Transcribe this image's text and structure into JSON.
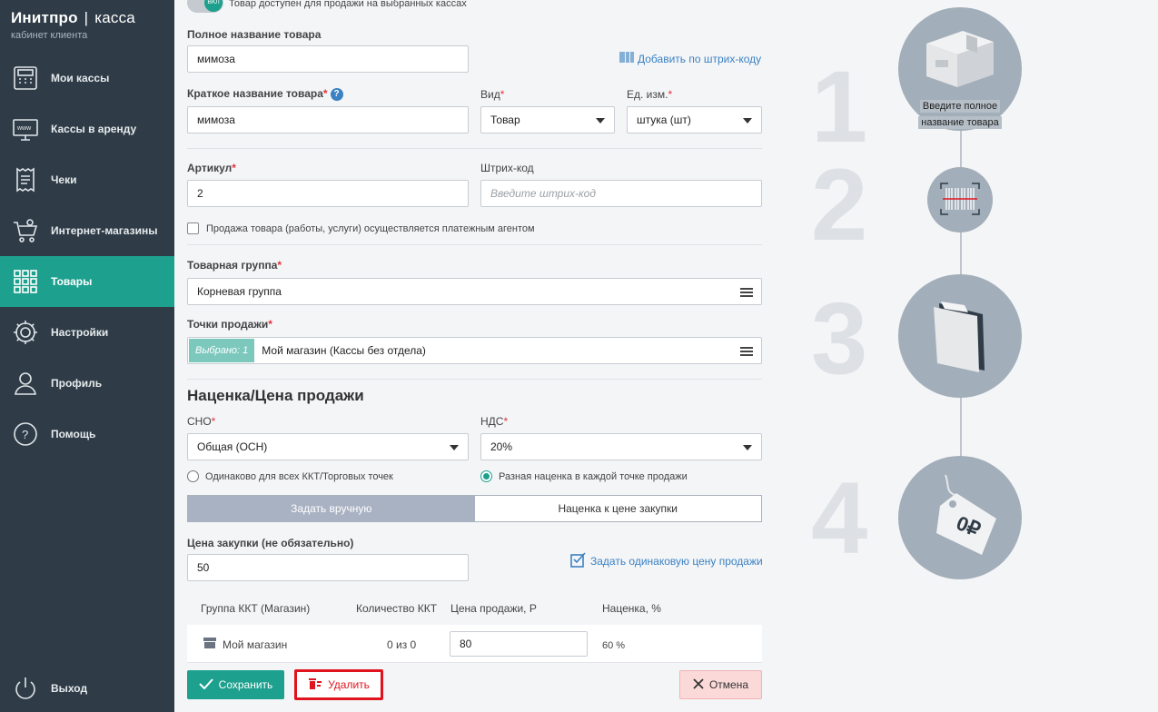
{
  "brand": {
    "title": "Инитпро",
    "separator": "|",
    "product": "касса",
    "subtitle": "кабинет клиента"
  },
  "sidebar": {
    "items": [
      {
        "label": "Мои кассы",
        "icon": "cash-register-icon"
      },
      {
        "label": "Кассы в аренду",
        "icon": "www-monitor-icon"
      },
      {
        "label": "Чеки",
        "icon": "receipt-icon"
      },
      {
        "label": "Интернет-магазины",
        "icon": "cart-icon"
      },
      {
        "label": "Товары",
        "icon": "grid-icon",
        "active": true
      },
      {
        "label": "Настройки",
        "icon": "gear-icon"
      },
      {
        "label": "Профиль",
        "icon": "profile-icon"
      },
      {
        "label": "Помощь",
        "icon": "help-icon"
      }
    ],
    "logout": {
      "label": "Выход",
      "icon": "power-icon"
    }
  },
  "form": {
    "availability_toggle": {
      "state": "ВКЛ",
      "label": "Товар доступен для продажи на выбранных кассах"
    },
    "full_name": {
      "label": "Полное название товара",
      "value": "мимоза"
    },
    "barcode_link": "Добавить по штрих-коду",
    "short_name": {
      "label": "Краткое название товара",
      "required": "*",
      "help": "?",
      "value": "мимоза"
    },
    "kind": {
      "label": "Вид",
      "required": "*",
      "value": "Товар"
    },
    "unit": {
      "label": "Ед. изм.",
      "required": "*",
      "value": "штука (шт)"
    },
    "article": {
      "label": "Артикул",
      "required": "*",
      "value": "2"
    },
    "barcode": {
      "label": "Штрих-код",
      "placeholder": "Введите штрих-код"
    },
    "agent_checkbox": "Продажа товара (работы, услуги) осуществляется платежным агентом",
    "product_group": {
      "label": "Товарная группа",
      "required": "*",
      "value": "Корневая группа"
    },
    "sale_points": {
      "label": "Точки продажи",
      "required": "*",
      "selected_badge": "Выбрано: 1",
      "value": "Мой магазин (Кассы без отдела)"
    },
    "markup_title": "Наценка/Цена продажи",
    "sno": {
      "label": "СНО",
      "required": "*",
      "value": "Общая (ОСН)"
    },
    "nds": {
      "label": "НДС",
      "required": "*",
      "value": "20%"
    },
    "radio_same": "Одинаково для всех ККТ/Торговых точек",
    "radio_diff": "Разная наценка в каждой точке продажи",
    "tab_manual": "Задать вручную",
    "tab_purchase": "Наценка к цене закупки",
    "purchase_price": {
      "label": "Цена закупки (не обязательно)",
      "value": "50"
    },
    "same_price_checkbox": "Задать одинаковую цену продажи",
    "table": {
      "headers": [
        "Группа ККТ (Магазин)",
        "Количество ККТ",
        "Цена продажи, Р",
        "Наценка, %"
      ],
      "row": {
        "group": "Мой магазин",
        "count": "0 из 0",
        "price": "80",
        "markup": "60 %"
      }
    },
    "buttons": {
      "save": "Сохранить",
      "delete": "Удалить",
      "cancel": "Отмена"
    }
  },
  "steps": {
    "numbers": [
      "1",
      "2",
      "3",
      "4"
    ],
    "step1_label_line1": "Введите полное",
    "step1_label_line2": "название товара",
    "price_tag_text": "0₽"
  },
  "colors": {
    "sidebar_bg": "#2f3c47",
    "accent": "#1da08e",
    "delete_red": "#e0141e",
    "link": "#3b82c4",
    "step_circle": "#a2aeb9"
  }
}
